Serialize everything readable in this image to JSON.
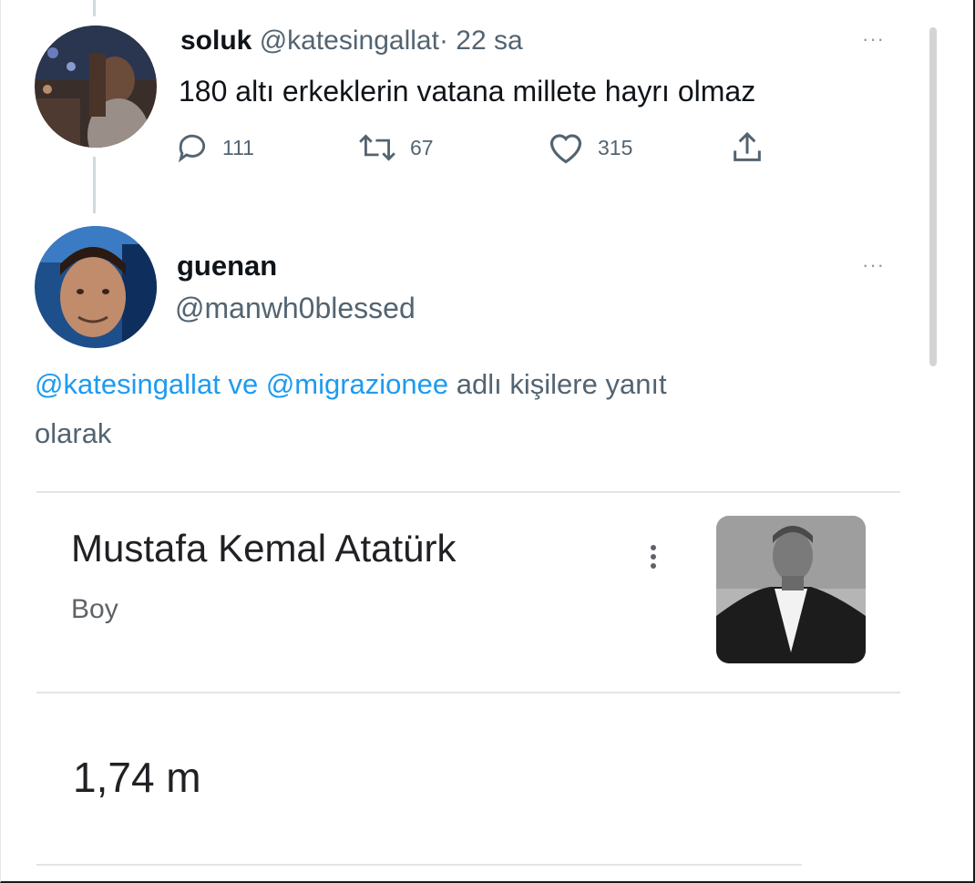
{
  "tweet": {
    "display_name": "soluk",
    "handle": "@katesingallat",
    "separator": "·",
    "time": "22 sa",
    "text": "180 altı erkeklerin vatana millete hayrı olmaz",
    "replies": "111",
    "retweets": "67",
    "likes": "315",
    "more_icon": "more-dots-icon"
  },
  "reply": {
    "display_name": "guenan",
    "handle": "@manwh0blessed",
    "reply_mention_1": "@katesingallat",
    "reply_conjunction": "ve",
    "reply_mention_2": "@migrazionee",
    "reply_suffix": "adlı kişilere yanıt",
    "reply_suffix_line2": "olarak"
  },
  "search_card": {
    "title": "Mustafa Kemal Atatürk",
    "subtitle": "Boy",
    "value": "1,74 m"
  },
  "colors": {
    "accent": "#1d9bf0",
    "text": "#0f1419",
    "muted": "#536471"
  }
}
